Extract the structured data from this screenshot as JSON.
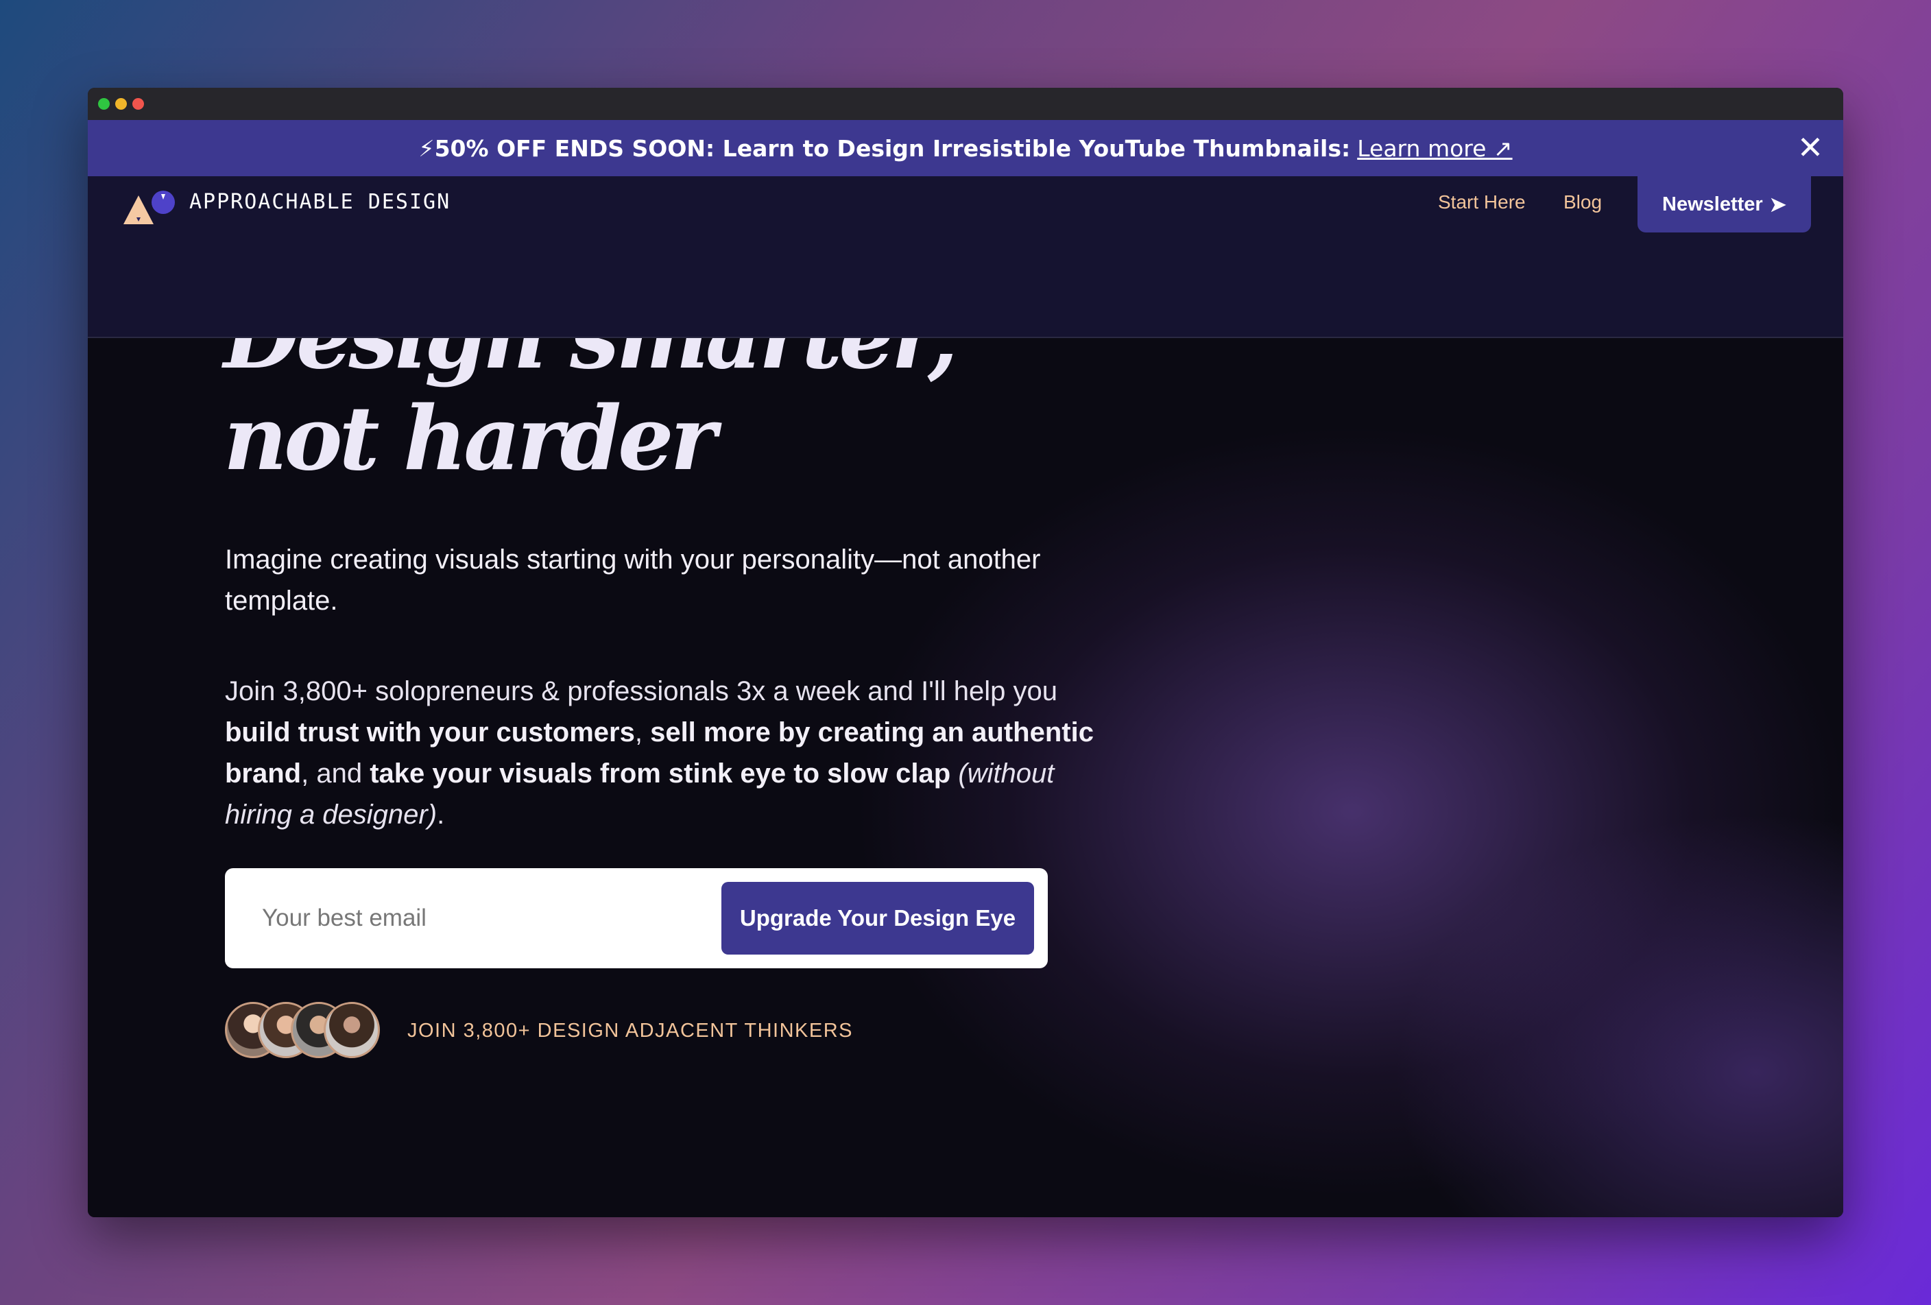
{
  "window": {
    "traffic_lights": [
      "green",
      "yellow",
      "red"
    ]
  },
  "banner": {
    "icon": "lightning-icon",
    "icon_glyph": "⚡",
    "text": "50% OFF ENDS SOON: Learn to Design Irresistible YouTube Thumbnails:",
    "link_label": "Learn more ↗",
    "close_glyph": "✕"
  },
  "nav": {
    "brand": "APPROACHABLE DESIGN",
    "links": [
      {
        "label": "Start Here"
      },
      {
        "label": "Blog"
      }
    ],
    "newsletter_label": "Newsletter",
    "newsletter_arrow": "➤"
  },
  "hero": {
    "headline_line1": "Design smarter,",
    "headline_line2": "not harder",
    "subheadline": "Imagine creating visuals starting with your personality—not another template.",
    "pitch": {
      "t1": "Join 3,800+ solopreneurs & professionals 3x a week and I'll help you ",
      "b1": "build trust with your customers",
      "t2": ", ",
      "b2": "sell more by creating an authentic brand",
      "t3": ", and ",
      "b3": "take your visuals from stink eye to slow clap",
      "t4": " ",
      "i1": "(without hiring a designer)",
      "t5": "."
    },
    "form": {
      "email_placeholder": "Your best email",
      "email_value": "",
      "cta_label": "Upgrade Your Design Eye"
    },
    "social_proof": "JOIN 3,800+ DESIGN ADJACENT THINKERS"
  },
  "colors": {
    "accent": "#3d3890",
    "nav_link": "#f2c49a",
    "nav_bg": "#151330",
    "hero_bg": "#0b0a13"
  }
}
